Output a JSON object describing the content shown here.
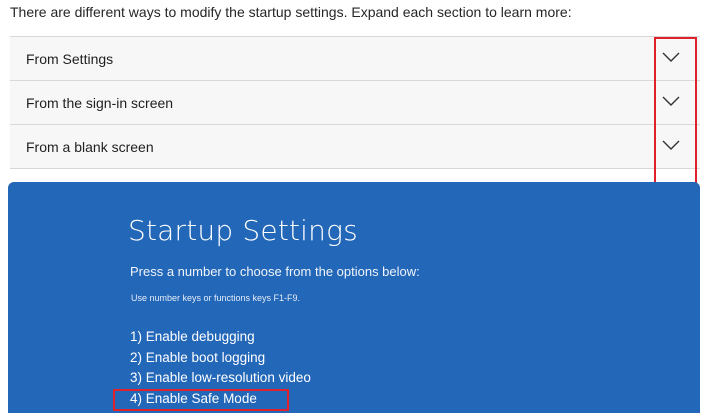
{
  "intro": "There are different ways to modify the startup settings. Expand each section to learn more:",
  "accordion": {
    "items": [
      {
        "label": "From Settings",
        "icon": "chevron-down-icon"
      },
      {
        "label": "From the sign-in screen",
        "icon": "chevron-down-icon"
      },
      {
        "label": "From a blank screen",
        "icon": "chevron-down-icon"
      }
    ]
  },
  "screenshot": {
    "title": "Startup Settings",
    "subtitle": "Press a number to choose from the options below:",
    "note": "Use number keys or functions keys F1-F9.",
    "options": [
      "1) Enable debugging",
      "2) Enable boot logging",
      "3) Enable low-resolution video",
      "4) Enable Safe Mode"
    ]
  },
  "colors": {
    "accordion_bg": "#f7f7f7",
    "screen_bg": "#2367b8",
    "highlight": "#e0202a"
  }
}
